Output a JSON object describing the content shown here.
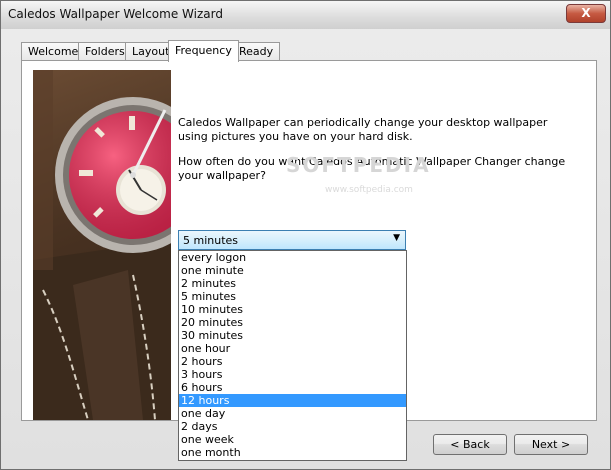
{
  "window": {
    "title": "Caledos Wallpaper Welcome Wizard",
    "close_label": "X"
  },
  "tabs": [
    {
      "label": "Welcome"
    },
    {
      "label": "Folders"
    },
    {
      "label": "Layout"
    },
    {
      "label": "Frequency"
    },
    {
      "label": "Ready"
    }
  ],
  "active_tab": "Frequency",
  "main": {
    "intro": "Caledos Wallpaper can periodically change your desktop wallpaper using pictures you have on your hard disk.",
    "question": "How often do you want Caledos Automatic Wallpaper Changer change your wallpaper?",
    "watermark": "SOFTPEDIA",
    "watermark_url": "www.softpedia.com"
  },
  "frequency": {
    "selected_value": "5 minutes",
    "highlighted_option": "12 hours",
    "options": [
      "every logon",
      "one minute",
      "2 minutes",
      "5 minutes",
      "10 minutes",
      "20 minutes",
      "30 minutes",
      "one hour",
      "2 hours",
      "3 hours",
      "6 hours",
      "12 hours",
      "one day",
      "2 days",
      "one week",
      "one month"
    ]
  },
  "buttons": {
    "back": "< Back",
    "next": "Next >"
  }
}
